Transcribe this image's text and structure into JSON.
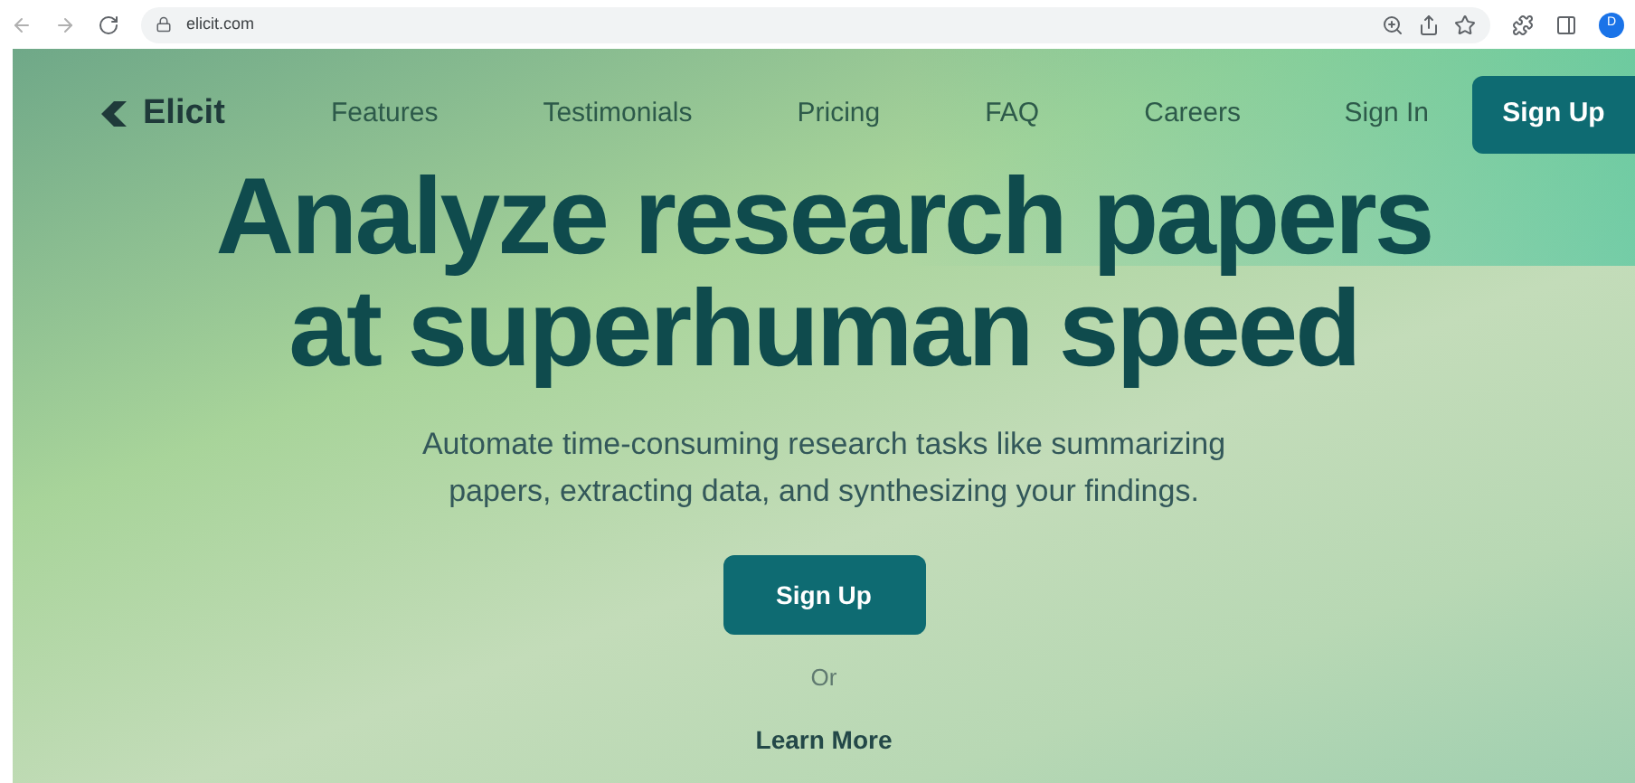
{
  "browser": {
    "url": "elicit.com",
    "profile_initial": "D"
  },
  "nav": {
    "brand": "Elicit",
    "links": [
      "Features",
      "Testimonials",
      "Pricing",
      "FAQ",
      "Careers"
    ],
    "sign_in": "Sign In",
    "sign_up": "Sign Up"
  },
  "hero": {
    "headline_lines": [
      "Analyze research papers",
      "at superhuman speed"
    ],
    "subtitle_lines": [
      "Automate time-consuming research tasks like summarizing",
      "papers, extracting data, and synthesizing your findings."
    ],
    "cta": "Sign Up",
    "or": "Or",
    "learn_more": "Learn More"
  }
}
